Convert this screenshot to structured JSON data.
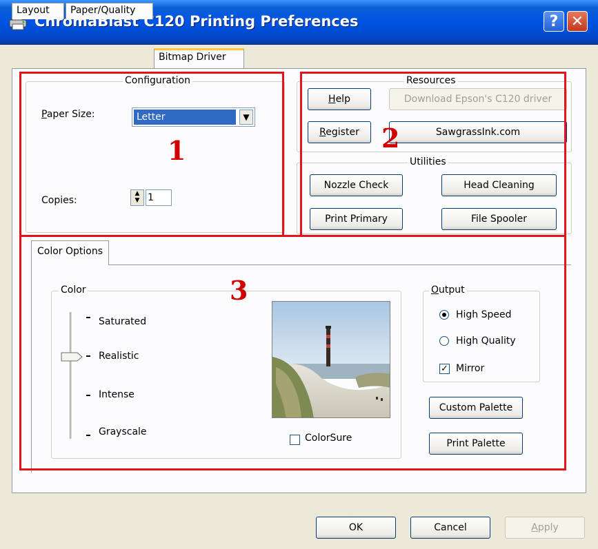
{
  "window": {
    "title": "ChromaBlast C120 Printing Preferences"
  },
  "tabs": [
    {
      "label": "Layout"
    },
    {
      "label": "Paper/Quality"
    },
    {
      "label": "Bitmap Driver",
      "active": true
    }
  ],
  "configuration": {
    "title": "Configuration",
    "paper_size_label": "Paper Size:",
    "paper_size_value": "Letter",
    "copies_label": "Copies:",
    "copies_value": "1"
  },
  "resources": {
    "title": "Resources",
    "help": "Help",
    "download": "Download Epson's C120 driver",
    "register": "Register",
    "website": "SawgrassInk.com"
  },
  "utilities": {
    "title": "Utilities",
    "nozzle_check": "Nozzle Check",
    "head_cleaning": "Head Cleaning",
    "print_primary": "Print Primary",
    "file_spooler": "File Spooler"
  },
  "color_options": {
    "tab_label": "Color Options",
    "color_group": "Color",
    "levels": [
      "Saturated",
      "Realistic",
      "Intense",
      "Grayscale"
    ],
    "selected_level": "Realistic",
    "colorsure_label": "ColorSure",
    "colorsure_checked": false
  },
  "output": {
    "title": "Output",
    "high_speed": "High Speed",
    "high_quality": "High Quality",
    "selected": "High Speed",
    "mirror": "Mirror",
    "mirror_checked": true,
    "custom_palette": "Custom Palette",
    "print_palette": "Print Palette"
  },
  "annotations": [
    "1",
    "2",
    "3"
  ],
  "annotation_color": "#e0141a",
  "footer": {
    "ok": "OK",
    "cancel": "Cancel",
    "apply": "Apply"
  }
}
